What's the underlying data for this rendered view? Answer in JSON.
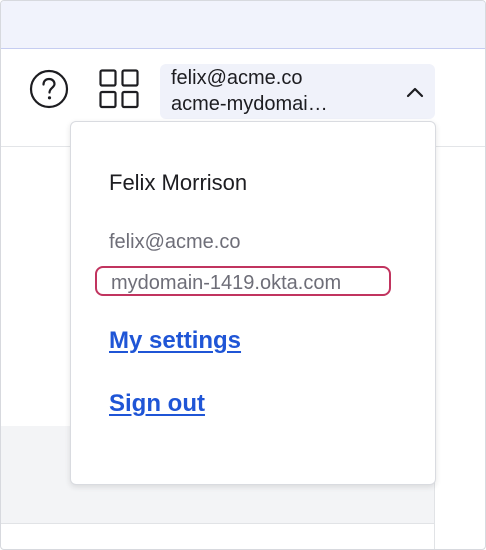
{
  "header": {
    "help_icon": "question-circle-icon",
    "apps_icon": "app-grid-icon",
    "account": {
      "email": "felix@acme.co",
      "domain": "acme-mydomai…",
      "chevron_icon": "chevron-up-icon"
    }
  },
  "dropdown": {
    "name": "Felix Morrison",
    "email": "felix@acme.co",
    "okta_domain": "mydomain-1419.okta.com",
    "links": {
      "settings": "My settings",
      "sign_out": "Sign out"
    }
  },
  "colors": {
    "banner": "#f1f3fc",
    "account_bg": "#f0f2fa",
    "link": "#1f55d6",
    "focus_ring": "#c1345f",
    "muted_text": "#6e6e78"
  }
}
